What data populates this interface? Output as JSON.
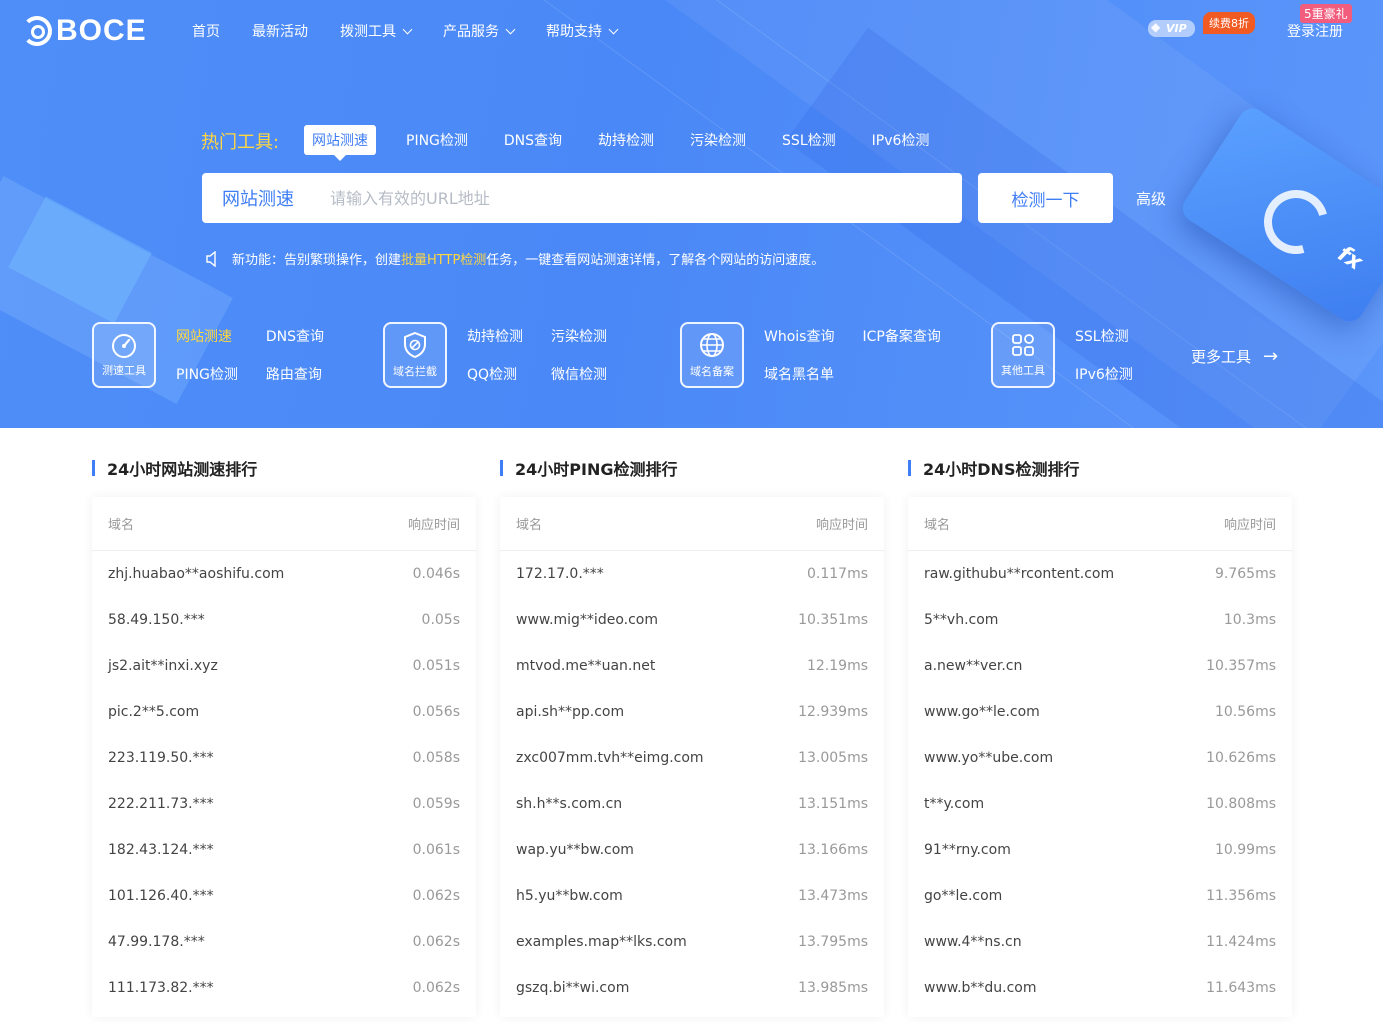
{
  "header": {
    "logo_text": "BOCE",
    "nav": [
      {
        "label": "首页",
        "dropdown": false
      },
      {
        "label": "最新活动",
        "dropdown": false
      },
      {
        "label": "拨测工具",
        "dropdown": true
      },
      {
        "label": "产品服务",
        "dropdown": true
      },
      {
        "label": "帮助支持",
        "dropdown": true
      }
    ],
    "vip_label": "VIP",
    "vip_discount": "续费8折",
    "promo_badge": "5重豪礼",
    "login_label": "登录注册"
  },
  "hot_tools": {
    "label": "热门工具:",
    "tabs": [
      "网站测速",
      "PING检测",
      "DNS查询",
      "劫持检测",
      "污染检测",
      "SSL检测",
      "IPv6检测"
    ],
    "active_tab": "网站测速"
  },
  "search": {
    "type_label": "网站测速",
    "placeholder": "请输入有效的URL地址",
    "value": "",
    "button_label": "检测一下",
    "advanced_label": "高级"
  },
  "notice": {
    "prefix": "新功能：告别繁琐操作，创建",
    "highlight": "批量HTTP检测",
    "suffix": "任务，一键查看网站测速详情，了解各个网站的访问速度。"
  },
  "tool_groups": [
    {
      "icon": "speedometer-icon",
      "title": "测速工具",
      "links": [
        "网站测速",
        "DNS查询",
        "PING检测",
        "路由查询"
      ],
      "active": "网站测速"
    },
    {
      "icon": "shield-block-icon",
      "title": "域名拦截",
      "links": [
        "劫持检测",
        "污染检测",
        "QQ检测",
        "微信检测"
      ],
      "active": ""
    },
    {
      "icon": "globe-icon",
      "title": "域名备案",
      "links": [
        "Whois查询",
        "ICP备案查询",
        "域名黑名单"
      ],
      "active": ""
    },
    {
      "icon": "grid-apps-icon",
      "title": "其他工具",
      "links": [
        "SSL检测",
        "IPv6检测"
      ],
      "active": ""
    }
  ],
  "more_tools_label": "更多工具",
  "rankings": [
    {
      "title": "24小时网站测速排行",
      "col_domain": "域名",
      "col_time": "响应时间",
      "rows": [
        {
          "domain": "zhj.huabao**aoshifu.com",
          "time": "0.046s"
        },
        {
          "domain": "58.49.150.***",
          "time": "0.05s"
        },
        {
          "domain": "js2.ait**inxi.xyz",
          "time": "0.051s"
        },
        {
          "domain": "pic.2**5.com",
          "time": "0.056s"
        },
        {
          "domain": "223.119.50.***",
          "time": "0.058s"
        },
        {
          "domain": "222.211.73.***",
          "time": "0.059s"
        },
        {
          "domain": "182.43.124.***",
          "time": "0.061s"
        },
        {
          "domain": "101.126.40.***",
          "time": "0.062s"
        },
        {
          "domain": "47.99.178.***",
          "time": "0.062s"
        },
        {
          "domain": "111.173.82.***",
          "time": "0.062s"
        }
      ]
    },
    {
      "title": "24小时PING检测排行",
      "col_domain": "域名",
      "col_time": "响应时间",
      "rows": [
        {
          "domain": "172.17.0.***",
          "time": "0.117ms"
        },
        {
          "domain": "www.mig**ideo.com",
          "time": "10.351ms"
        },
        {
          "domain": "mtvod.me**uan.net",
          "time": "12.19ms"
        },
        {
          "domain": "api.sh**pp.com",
          "time": "12.939ms"
        },
        {
          "domain": "zxc007mm.tvh**eimg.com",
          "time": "13.005ms"
        },
        {
          "domain": "sh.h**s.com.cn",
          "time": "13.151ms"
        },
        {
          "domain": "wap.yu**bw.com",
          "time": "13.166ms"
        },
        {
          "domain": "h5.yu**bw.com",
          "time": "13.473ms"
        },
        {
          "domain": "examples.map**lks.com",
          "time": "13.795ms"
        },
        {
          "domain": "gszq.bi**wi.com",
          "time": "13.985ms"
        }
      ]
    },
    {
      "title": "24小时DNS检测排行",
      "col_domain": "域名",
      "col_time": "响应时间",
      "rows": [
        {
          "domain": "raw.githubu**rcontent.com",
          "time": "9.765ms"
        },
        {
          "domain": "5**vh.com",
          "time": "10.3ms"
        },
        {
          "domain": "a.new**ver.cn",
          "time": "10.357ms"
        },
        {
          "domain": "www.go**le.com",
          "time": "10.56ms"
        },
        {
          "domain": "www.yo**ube.com",
          "time": "10.626ms"
        },
        {
          "domain": "t**y.com",
          "time": "10.808ms"
        },
        {
          "domain": "91**rny.com",
          "time": "10.99ms"
        },
        {
          "domain": "go**le.com",
          "time": "11.356ms"
        },
        {
          "domain": "www.4**ns.cn",
          "time": "11.424ms"
        },
        {
          "domain": "www.b**du.com",
          "time": "11.643ms"
        }
      ]
    }
  ],
  "colors": {
    "hero_blue": "#4a88f7",
    "accent": "#3f7ef5",
    "highlight_yellow": "#ffd740",
    "discount_orange": "#f15a22",
    "promo_pink": "#f25d7e"
  }
}
